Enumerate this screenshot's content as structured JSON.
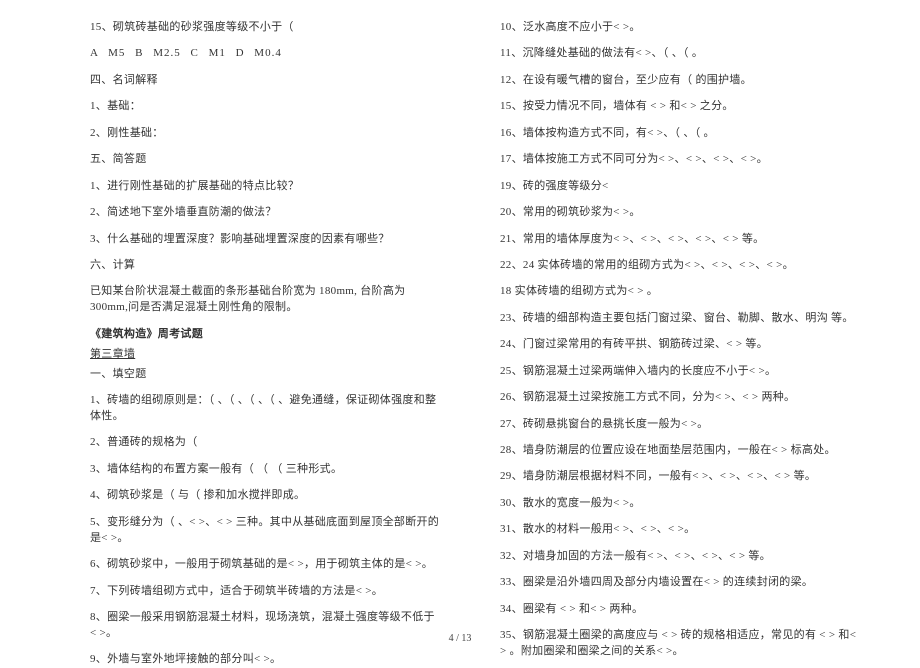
{
  "left": {
    "q15": "15、砌筑砖基础的砂浆强度等级不小于（",
    "q15_opts": "A   M5     B    M2.5      C   M1      D M0.4",
    "sec4": "四、名词解释",
    "nc1": "1、基础：",
    "nc2": "2、刚性基础：",
    "sec5": "五、简答题",
    "jd1": "1、进行刚性基础的扩展基础的特点比较？",
    "jd2": "2、简述地下室外墙垂直防潮的做法？",
    "jd3": "3、什么基础的埋置深度？影响基础埋置深度的因素有哪些？",
    "sec6": "六、计算",
    "calc": "已知某台阶状混凝土截面的条形基础台阶宽为 180mm, 台阶高为 300mm,问是否满足混凝土刚性角的限制。",
    "title": "《建筑构造》周考试题",
    "subtitle": "第三章墙",
    "sub1": "一、填空题",
    "l1": "1、砖墙的组砌原则是：（               、（             、（            、（           、避免通缝，保证砌体强度和整体性。",
    "l2": "2、普通砖的规格为（",
    "l3": "3、墙体结构的布置方案一般有（             （               （       三种形式。",
    "l4": "4、砌筑砂浆是（              与（                 掺和加水搅拌即成。",
    "l5": "5、变形缝分为（       、<          >、<        > 三种。其中从基础底面到屋顶全部断开的是<          >。",
    "l6": "6、砌筑砂浆中，一般用于砌筑基础的是<         >，用于砌筑主体的是<           >。",
    "l7": "7、下列砖墙组砌方式中，适合于砌筑半砖墙的方法是<           >。",
    "l8": "8、圈梁一般采用钢筋混凝土材料，现场浇筑，混凝土强度等级不低于<       >。",
    "l9": "9、外墙与室外地坪接触的部分叫<         >。"
  },
  "right": {
    "r10": "10、泛水高度不应小于<              >。",
    "r11": "11、沉降缝处基础的做法有<               >、（              、（               。",
    "r12": "12、在设有暖气槽的窗台，至少应有（           的围护墙。",
    "r15": "15、按受力情况不同，墙体有    <           > 和<             >   之分。",
    "r16": "16、墙体按构造方式不同，有<            >、（          、（            。",
    "r17": "17、墙体按施工方式不同可分为<               >、<           >、<             >、<           >。",
    "r19": "19、砖的强度等级分<",
    "r20": "20、常用的砌筑砂浆为<            >。",
    "r21": "21、常用的墙体厚度为<               >、<           >、<           >、<           >、<           >  等。",
    "r22": "22、24 实体砖墙的常用的组砌方式为<             >、<          >、<             >、<          >。",
    "r18": "18 实体砖墙的组砌方式为<                      >               。",
    "r23": "23、砖墙的细部构造主要包括门窗过梁、窗台、勒脚、散水、明沟                    等。",
    "r24": "24、门窗过梁常用的有砖平拱、钢筋砖过梁、<               > 等。",
    "r25": "25、钢筋混凝土过梁两端伸入墙内的长度应不小于<               >。",
    "r26": "26、钢筋混凝土过梁按施工方式不同，分为<              >、<           > 两种。",
    "r27": "27、砖砌悬挑窗台的悬挑长度一般为<               >。",
    "r28": "28、墙身防潮层的位置应设在地面垫层范围内，一般在<             >        标高处。",
    "r29": "29、墙身防潮层根据材料不同，一般有<              >、<          >、<           >、<           > 等。",
    "r30": "30、散水的宽度一般为<            >。",
    "r31": "31、散水的材料一般用<               >、<            >、<            >。",
    "r32": "32、对墙身加固的方法一般有<              >、<              >、<              >、<              > 等。",
    "r33": "33、圈梁是沿外墙四周及部分内墙设置在<             > 的连续封闭的梁。",
    "r34": "34、圈梁有    <              > 和<              >       两种。",
    "r35": "35、钢筋混凝土圈梁的高度应与     <             >  砖的规格相适应，常见的有      <            >    和<             >   。附加圈梁和圈梁之间的关系<             >。"
  },
  "page": "4 / 13"
}
